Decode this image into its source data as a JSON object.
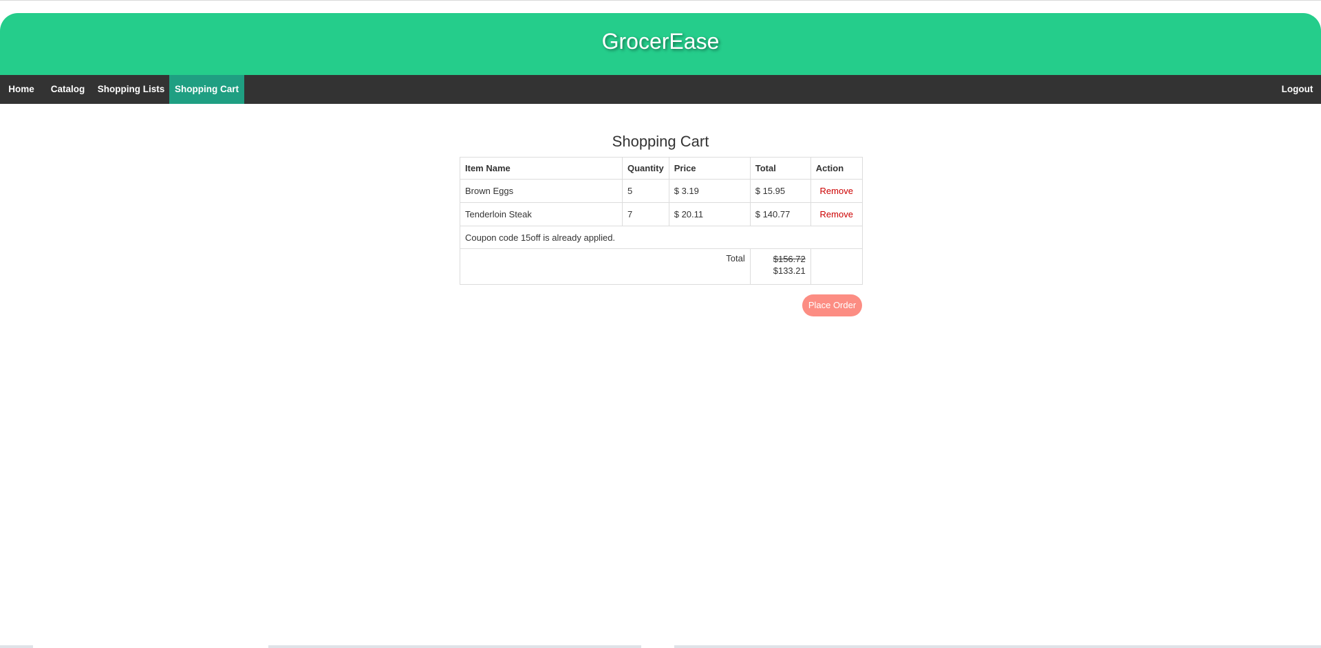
{
  "app": {
    "title": "GrocerEase"
  },
  "nav": {
    "items": [
      {
        "label": "Home"
      },
      {
        "label": "Catalog"
      },
      {
        "label": "Shopping Lists"
      },
      {
        "label": "Shopping Cart",
        "active": true
      }
    ],
    "logout_label": "Logout"
  },
  "cart": {
    "title": "Shopping Cart",
    "columns": [
      "Item Name",
      "Quantity",
      "Price",
      "Total",
      "Action"
    ],
    "rows": [
      {
        "name": "Brown Eggs",
        "quantity": "5",
        "price": "$ 3.19",
        "total": "$ 15.95",
        "action": "Remove"
      },
      {
        "name": "Tenderloin Steak",
        "quantity": "7",
        "price": "$ 20.11",
        "total": "$ 140.77",
        "action": "Remove"
      }
    ],
    "coupon_message": "Coupon code 15off is already applied.",
    "total_label": "Total",
    "original_total": "$156.72",
    "discounted_total": "$133.21",
    "place_order_label": "Place Order"
  },
  "colors": {
    "header_bg": "#25cd8b",
    "nav_bg": "#333333",
    "nav_active_bg": "#1f9f82",
    "remove_link": "#cc0000",
    "place_order_bg": "#fc8d83"
  }
}
